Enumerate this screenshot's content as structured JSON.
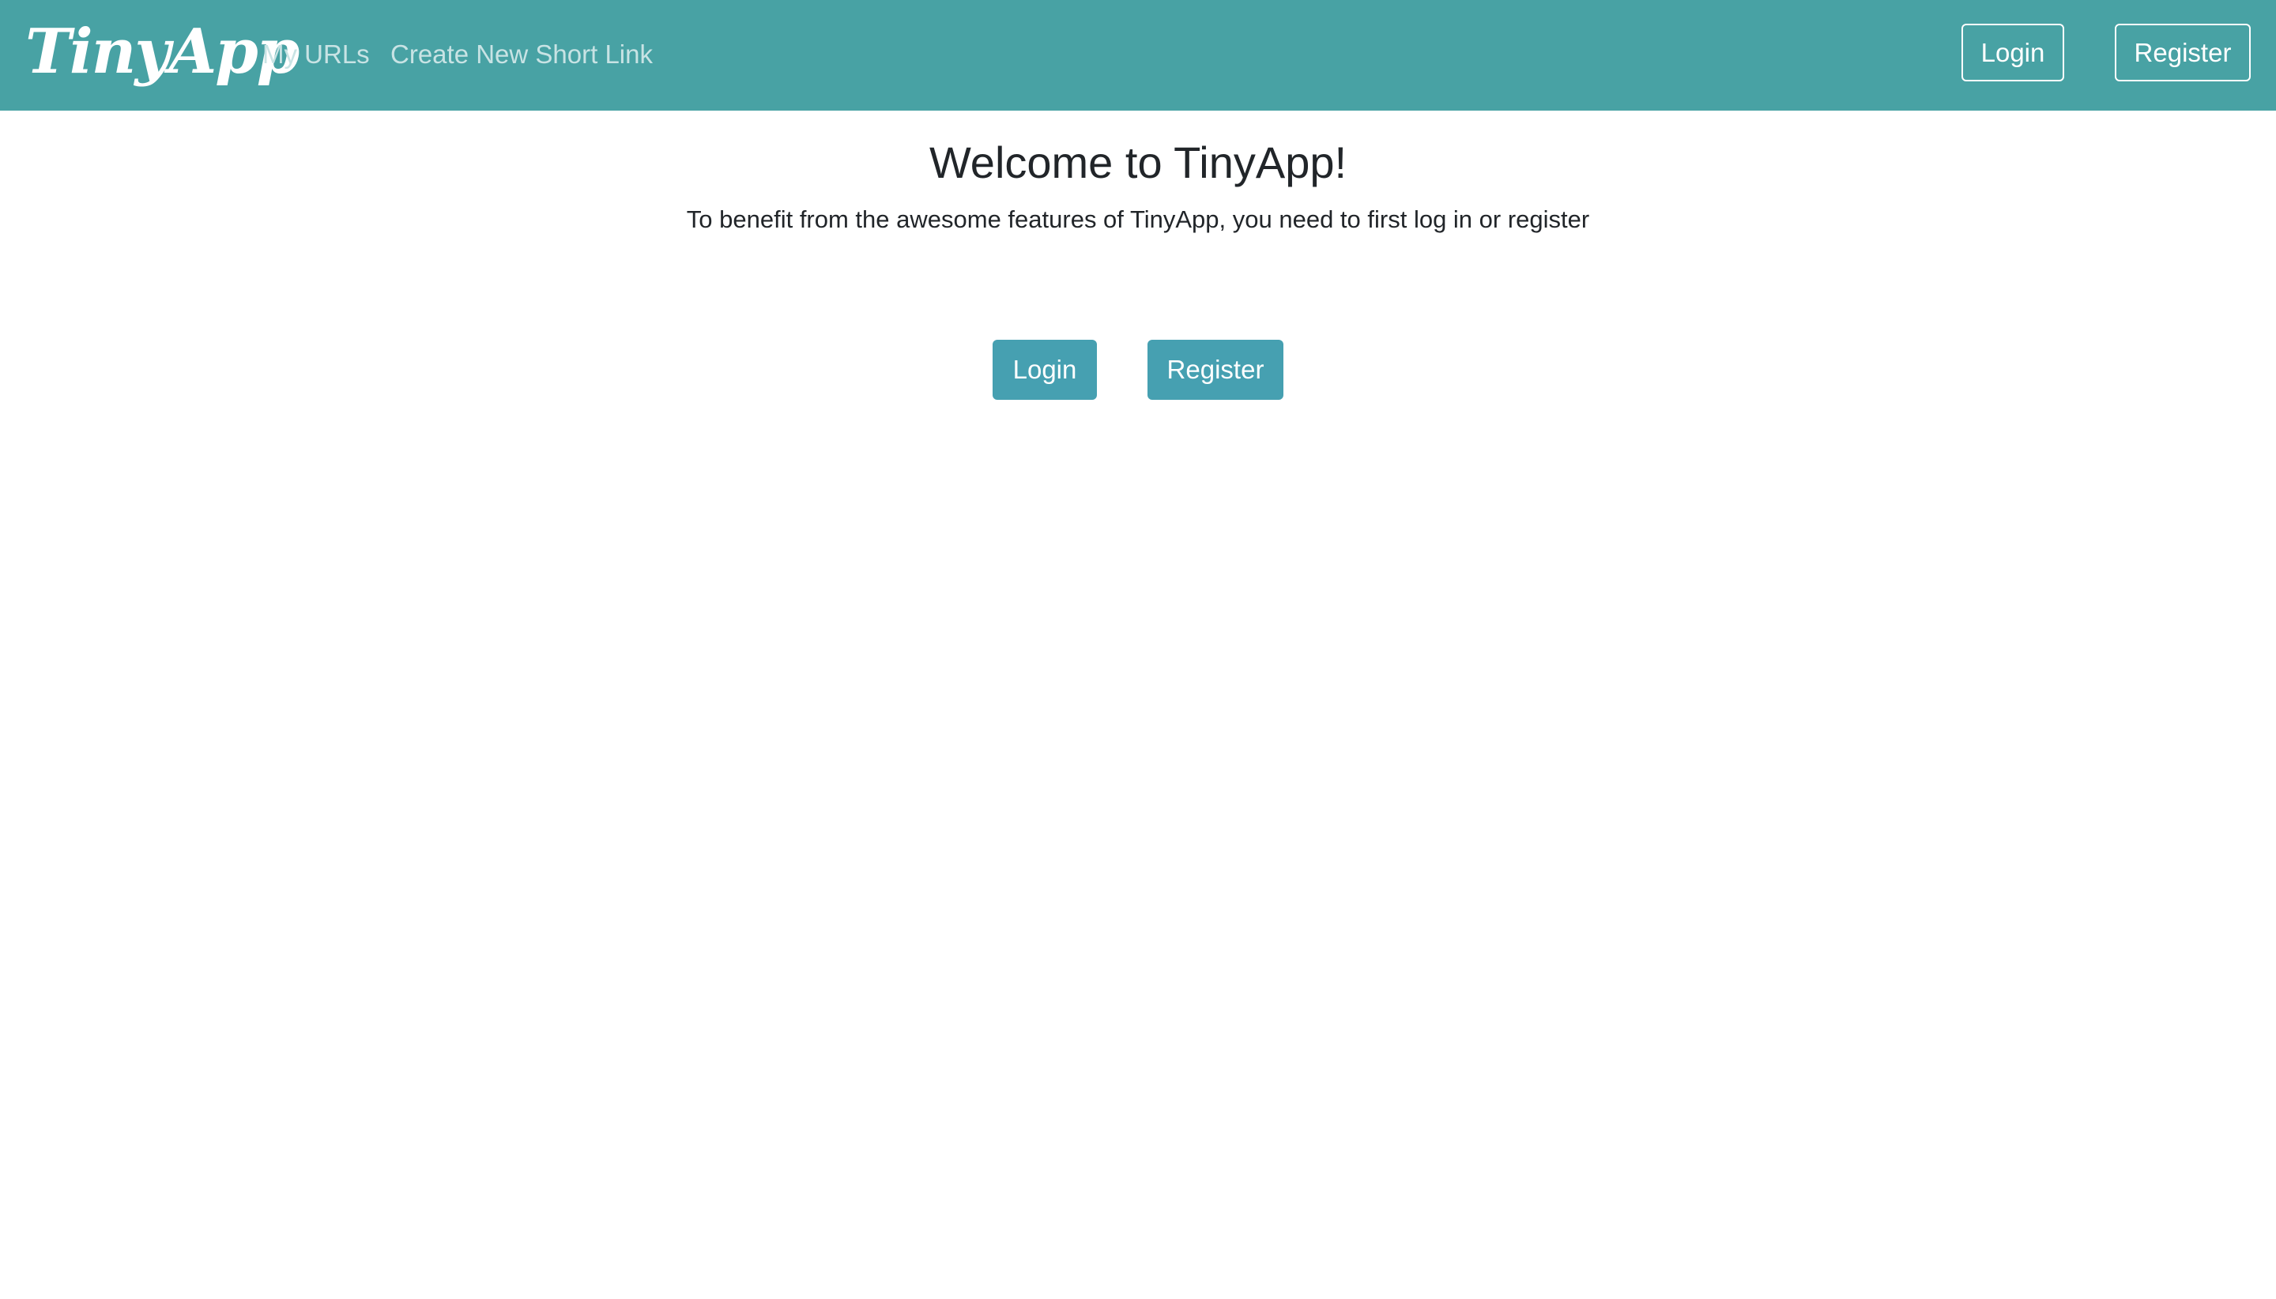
{
  "navbar": {
    "brand": "TinyApp",
    "links": [
      {
        "label": "My URLs"
      },
      {
        "label": "Create New Short Link"
      }
    ],
    "login_label": "Login",
    "register_label": "Register",
    "background_color": "#48a2a4"
  },
  "main": {
    "title": "Welcome to TinyApp!",
    "subtitle": "To benefit from the awesome features of TinyApp, you need to first log in or register",
    "login_label": "Login",
    "register_label": "Register",
    "button_color": "#46a0b1"
  }
}
